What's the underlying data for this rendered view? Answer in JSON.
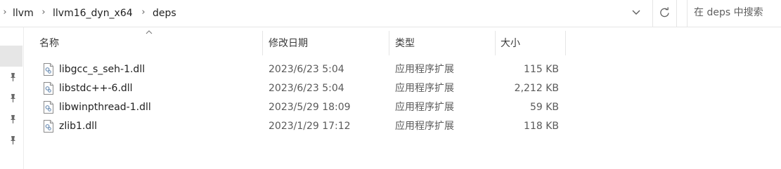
{
  "address": {
    "breadcrumbs": [
      "llvm",
      "llvm16_dyn_x64",
      "deps"
    ],
    "separator": "›",
    "search_placeholder": "在 deps 中搜索"
  },
  "columns": {
    "name": "名称",
    "date": "修改日期",
    "type": "类型",
    "size": "大小"
  },
  "files": [
    {
      "name": "libgcc_s_seh-1.dll",
      "date": "2023/6/23 5:04",
      "type": "应用程序扩展",
      "size": "115 KB"
    },
    {
      "name": "libstdc++-6.dll",
      "date": "2023/6/23 5:04",
      "type": "应用程序扩展",
      "size": "2,212 KB"
    },
    {
      "name": "libwinpthread-1.dll",
      "date": "2023/5/29 18:09",
      "type": "应用程序扩展",
      "size": "59 KB"
    },
    {
      "name": "zlib1.dll",
      "date": "2023/1/29 17:12",
      "type": "应用程序扩展",
      "size": "118 KB"
    }
  ],
  "icons": {
    "file": "dll-file-icon",
    "pin": "pin-icon",
    "refresh": "refresh-icon",
    "dropdown": "chevron-down-icon",
    "sort": "sort-ascending-icon"
  }
}
